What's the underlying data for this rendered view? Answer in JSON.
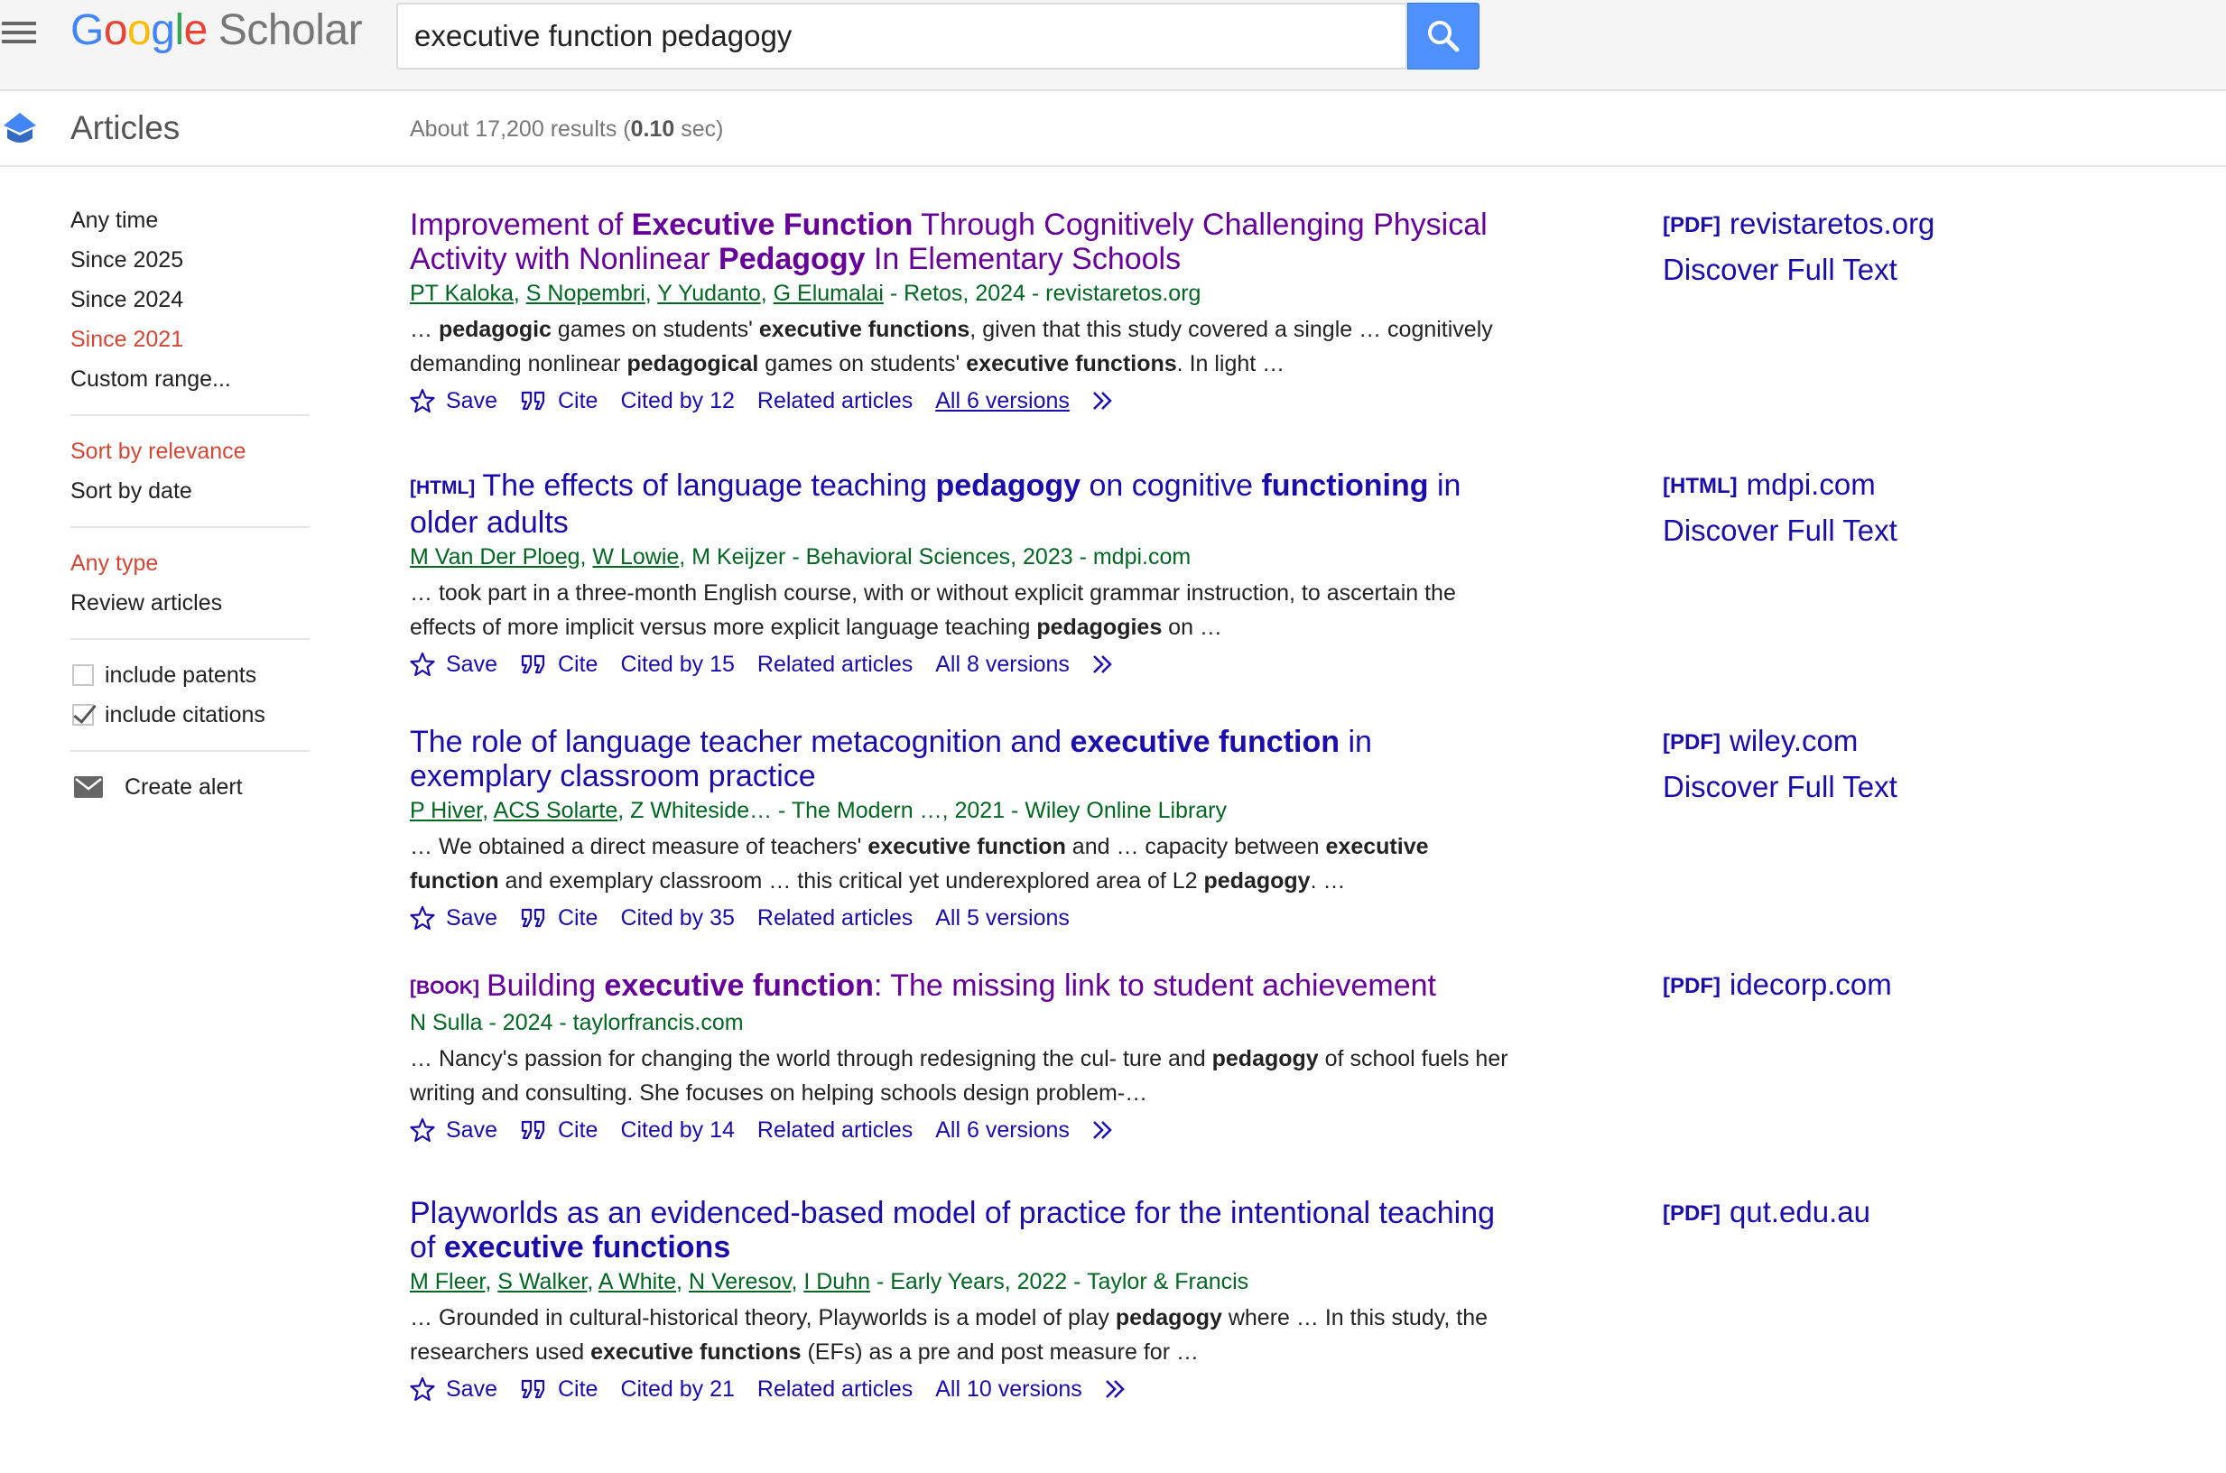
{
  "header": {
    "logo_google": [
      "G",
      "o",
      "o",
      "g",
      "l",
      "e"
    ],
    "logo_scholar": "Scholar",
    "search_value": "executive function pedagogy"
  },
  "subheader": {
    "section": "Articles",
    "stats_prefix": "About 17,200 results (",
    "stats_time": "0.10",
    "stats_suffix": " sec)"
  },
  "sidebar": {
    "time": [
      "Any time",
      "Since 2025",
      "Since 2024",
      "Since 2021",
      "Custom range..."
    ],
    "sort": [
      "Sort by relevance",
      "Sort by date"
    ],
    "type": [
      "Any type",
      "Review articles"
    ],
    "include_patents": "include patents",
    "include_citations": "include citations",
    "create_alert": "Create alert"
  },
  "results": [
    {
      "title": [
        [
          "Improvement of ",
          0
        ],
        [
          "Executive Function",
          1
        ],
        [
          " Through Cognitively Challenging Physical Activity with Nonlinear ",
          0
        ],
        [
          "Pedagogy",
          1
        ],
        [
          " In Elementary Schools",
          0
        ]
      ],
      "authors": [
        "PT Kaloka",
        "S Nopembri",
        "Y Yudanto",
        "G Elumalai"
      ],
      "authors_plain": "",
      "venue": " - Retos, 2024 - revistaretos.org",
      "snippet": [
        [
          "… ",
          0
        ],
        [
          "pedagogic",
          1
        ],
        [
          " games on students' ",
          0
        ],
        [
          "executive functions",
          1
        ],
        [
          ", given that this study covered a single … cognitively demanding nonlinear ",
          0
        ],
        [
          "pedagogical",
          1
        ],
        [
          " games on students' ",
          0
        ],
        [
          "executive functions",
          1
        ],
        [
          ". In light …",
          0
        ]
      ],
      "save": "Save",
      "cite": "Cite",
      "cited_by": "Cited by 12",
      "related": "Related articles",
      "versions": "All 6 versions",
      "side_tag": "[PDF]",
      "side_domain": "revistaretos.org",
      "discover": "Discover Full Text"
    },
    {
      "tag": "[HTML]",
      "title": [
        [
          "The effects of language teaching ",
          0
        ],
        [
          "pedagogy",
          1
        ],
        [
          " on cognitive ",
          0
        ],
        [
          "functioning",
          1
        ],
        [
          " in older adults",
          0
        ]
      ],
      "authors": [
        "M Van Der Ploeg",
        "W Lowie"
      ],
      "authors_plain": ", M Keijzer",
      "venue": " - Behavioral Sciences, 2023 - mdpi.com",
      "snippet": [
        [
          "… took part in a three-month English course, with or without explicit grammar instruction, to ascertain the effects of more implicit versus more explicit language teaching ",
          0
        ],
        [
          "pedagogies",
          1
        ],
        [
          " on …",
          0
        ]
      ],
      "save": "Save",
      "cite": "Cite",
      "cited_by": "Cited by 15",
      "related": "Related articles",
      "versions": "All 8 versions",
      "side_tag": "[HTML]",
      "side_domain": "mdpi.com",
      "discover": "Discover Full Text"
    },
    {
      "title": [
        [
          "The role of language teacher metacognition and ",
          0
        ],
        [
          "executive function",
          1
        ],
        [
          " in exemplary classroom practice",
          0
        ]
      ],
      "authors": [
        "P Hiver",
        "ACS Solarte"
      ],
      "authors_plain": ", Z Whiteside…",
      "venue": " - The Modern …, 2021 - Wiley Online Library",
      "snippet": [
        [
          "… We obtained a direct measure of teachers' ",
          0
        ],
        [
          "executive function",
          1
        ],
        [
          " and … capacity between ",
          0
        ],
        [
          "executive function",
          1
        ],
        [
          " and exemplary classroom … this critical yet underexplored area of L2 ",
          0
        ],
        [
          "pedagogy",
          1
        ],
        [
          ". …",
          0
        ]
      ],
      "save": "Save",
      "cite": "Cite",
      "cited_by": "Cited by 35",
      "related": "Related articles",
      "versions": "All 5 versions",
      "side_tag": "[PDF]",
      "side_domain": "wiley.com",
      "discover": "Discover Full Text"
    },
    {
      "tag": "[BOOK]",
      "title": [
        [
          "Building ",
          0
        ],
        [
          "executive function",
          1
        ],
        [
          ": The missing link to student achievement",
          0
        ]
      ],
      "authors": [],
      "authors_plain": "N Sulla",
      "venue": " - 2024 - taylorfrancis.com",
      "snippet": [
        [
          "… Nancy's passion for changing the world through redesigning the cul- ture and ",
          0
        ],
        [
          "pedagogy",
          1
        ],
        [
          " of school fuels her writing and consulting. She focuses on helping schools design problem-…",
          0
        ]
      ],
      "save": "Save",
      "cite": "Cite",
      "cited_by": "Cited by 14",
      "related": "Related articles",
      "versions": "All 6 versions",
      "side_tag": "[PDF]",
      "side_domain": "idecorp.com"
    },
    {
      "title": [
        [
          "Playworlds as an evidenced-based model of practice for the intentional teaching of ",
          0
        ],
        [
          "executive functions",
          1
        ]
      ],
      "authors": [
        "M Fleer",
        "S Walker",
        "A White",
        "N Veresov",
        "I Duhn"
      ],
      "authors_plain": "",
      "venue": " - Early Years, 2022 - Taylor & Francis",
      "snippet": [
        [
          "… Grounded in cultural-historical theory, Playworlds is a model of play ",
          0
        ],
        [
          "pedagogy",
          1
        ],
        [
          " where … In this study, the researchers used ",
          0
        ],
        [
          "executive functions",
          1
        ],
        [
          " (EFs) as a pre and post measure for …",
          0
        ]
      ],
      "save": "Save",
      "cite": "Cite",
      "cited_by": "Cited by 21",
      "related": "Related articles",
      "versions": "All 10 versions",
      "side_tag": "[PDF]",
      "side_domain": "qut.edu.au"
    }
  ],
  "colors": {
    "link": "#1a0dab",
    "visited": "#660099",
    "meta_green": "#006621",
    "selected_red": "#d14836",
    "search_blue": "#4d90fe",
    "logo": [
      "#4285f4",
      "#ea4335",
      "#fbbc05",
      "#4285f4",
      "#34a853",
      "#ea4335"
    ]
  }
}
